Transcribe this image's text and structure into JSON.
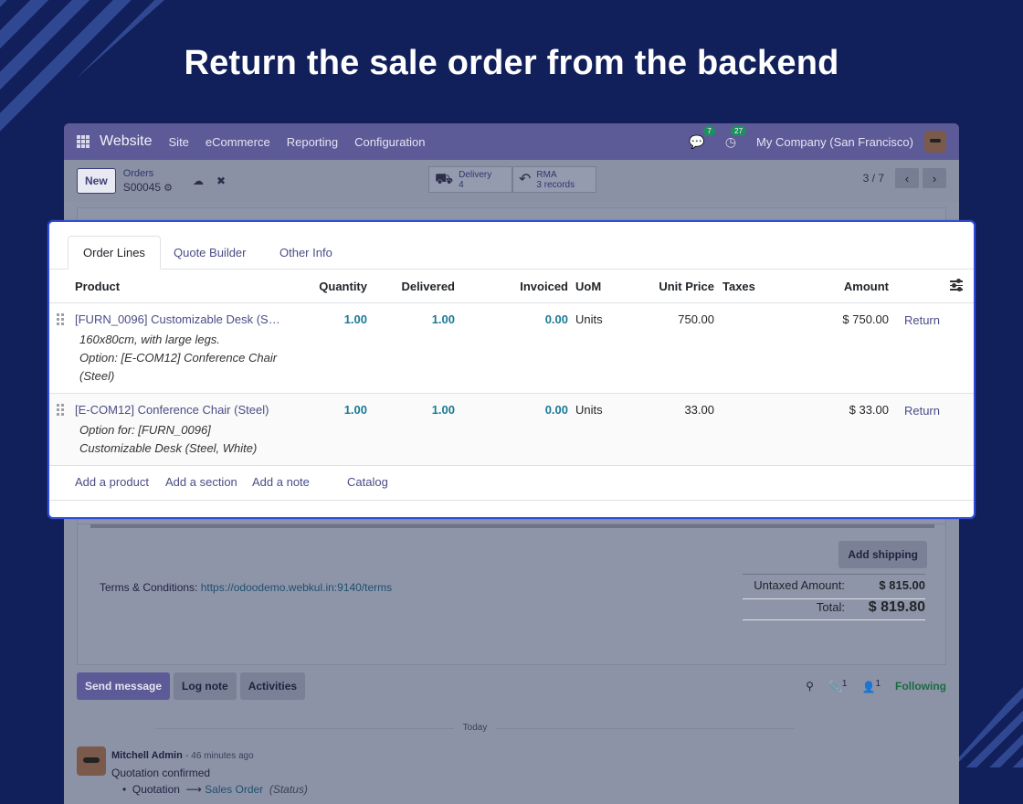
{
  "headline": "Return the sale order from the backend",
  "navbar": {
    "app_name": "Website",
    "menu": [
      "Site",
      "eCommerce",
      "Reporting",
      "Configuration"
    ],
    "messages_count": "7",
    "activities_count": "27",
    "company": "My Company (San Francisco)"
  },
  "control_panel": {
    "new_label": "New",
    "breadcrumb_parent": "Orders",
    "breadcrumb_current": "S00045",
    "smart_buttons": [
      {
        "label": "Delivery",
        "value": "4"
      },
      {
        "label": "RMA",
        "value": "3 records"
      }
    ],
    "pager": "3 / 7"
  },
  "tabs": [
    "Order Lines",
    "Quote Builder",
    "Other Info"
  ],
  "columns": [
    "Product",
    "Quantity",
    "Delivered",
    "Invoiced",
    "UoM",
    "Unit Price",
    "Taxes",
    "Amount"
  ],
  "lines": [
    {
      "product": "[FURN_0096] Customizable Desk (S…",
      "description": [
        "160x80cm, with large legs.",
        "Option: [E-COM12] Conference Chair",
        "(Steel)"
      ],
      "quantity": "1.00",
      "delivered": "1.00",
      "invoiced": "0.00",
      "uom": "Units",
      "unit_price": "750.00",
      "taxes": "",
      "amount": "$ 750.00",
      "action": "Return"
    },
    {
      "product": "[E-COM12] Conference Chair (Steel)",
      "description": [
        "Option for: [FURN_0096]",
        "Customizable Desk (Steel, White)"
      ],
      "quantity": "1.00",
      "delivered": "1.00",
      "invoiced": "0.00",
      "uom": "Units",
      "unit_price": "33.00",
      "taxes": "",
      "amount": "$ 33.00",
      "action": "Return"
    }
  ],
  "add_links": {
    "add_product": "Add a product",
    "add_section": "Add a section",
    "add_note": "Add a note",
    "catalog": "Catalog"
  },
  "footer": {
    "add_shipping": "Add shipping",
    "terms_label": "Terms & Conditions:",
    "terms_link": "https://odoodemo.webkul.in:9140/terms",
    "untaxed_label": "Untaxed Amount:",
    "untaxed_value": "$ 815.00",
    "total_label": "Total:",
    "total_value": "$ 819.80"
  },
  "chatter": {
    "send_message": "Send message",
    "log_note": "Log note",
    "activities": "Activities",
    "attachments_count": "1",
    "followers_count": "1",
    "following": "Following",
    "today": "Today",
    "message": {
      "author": "Mitchell Admin",
      "time": "- 46 minutes ago",
      "text": "Quotation confirmed",
      "old_value": "Quotation",
      "new_value": "Sales Order",
      "field": "(Status)"
    }
  }
}
